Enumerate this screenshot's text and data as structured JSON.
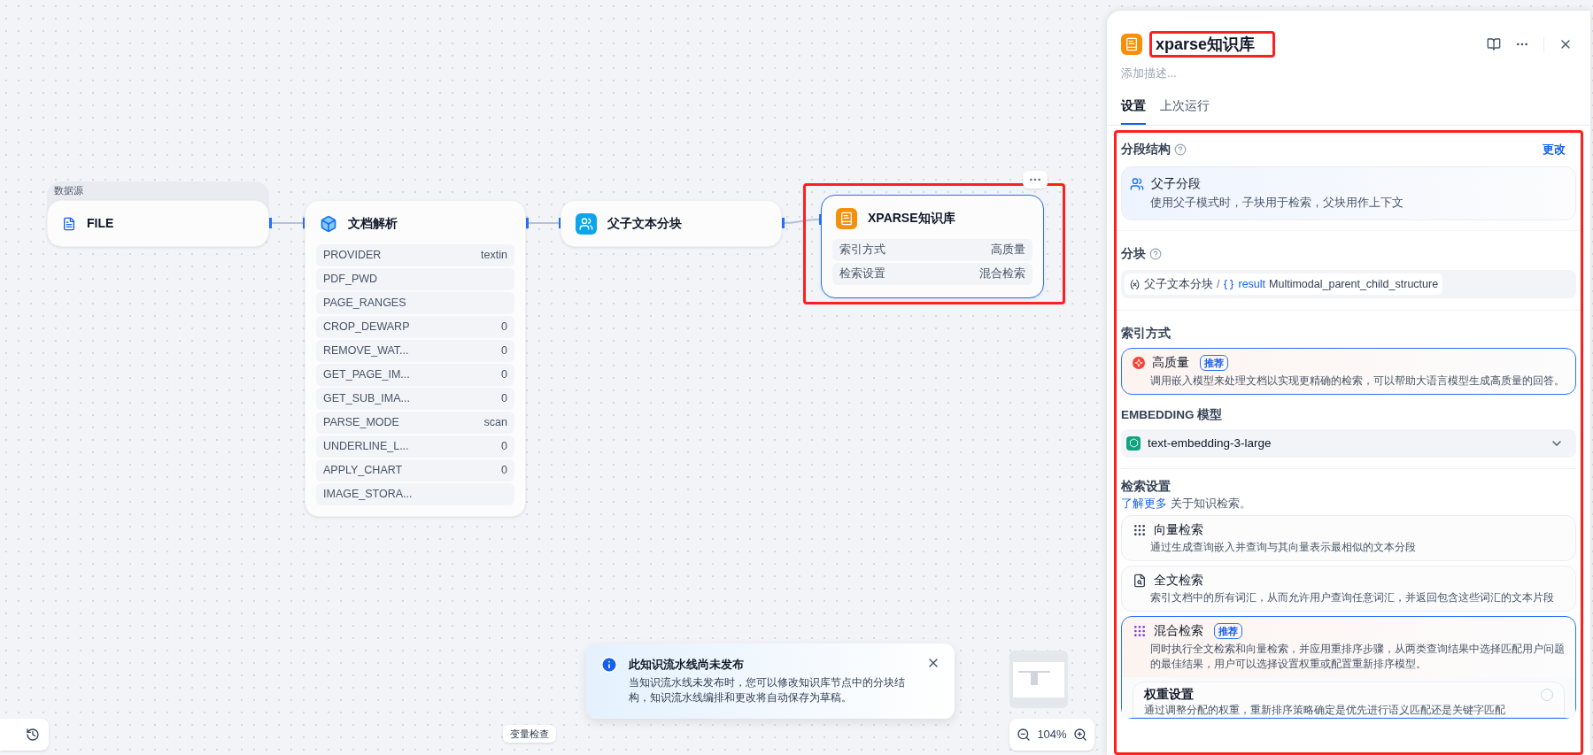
{
  "canvas": {
    "nodes": [
      {
        "kind": "source",
        "group_label": "数据源",
        "title": "FILE"
      },
      {
        "kind": "params",
        "title": "文档解析",
        "params": [
          {
            "name": "PROVIDER",
            "value": "textin"
          },
          {
            "name": "PDF_PWD"
          },
          {
            "name": "PAGE_RANGES"
          },
          {
            "name": "CROP_DEWARP",
            "value": "0"
          },
          {
            "name": "REMOVE_WAT...",
            "value": "0"
          },
          {
            "name": "GET_PAGE_IM...",
            "value": "0"
          },
          {
            "name": "GET_SUB_IMA...",
            "value": "0"
          },
          {
            "name": "PARSE_MODE",
            "value": "scan"
          },
          {
            "name": "UNDERLINE_L...",
            "value": "0"
          },
          {
            "name": "APPLY_CHART",
            "value": "0"
          },
          {
            "name": "IMAGE_STORA..."
          }
        ]
      },
      {
        "kind": "simple",
        "title": "父子文本分块"
      },
      {
        "kind": "knowledge",
        "title": "XPARSE知识库",
        "highlighted": true,
        "selected": true,
        "params": [
          {
            "name": "索引方式",
            "value": "高质量"
          },
          {
            "name": "检索设置",
            "value": "混合检索"
          }
        ]
      }
    ],
    "variable_inspect_button": "变量检查",
    "toast": {
      "title": "此知识流水线尚未发布",
      "message": "当知识流水线未发布时，您可以修改知识库节点中的分块结构，知识流水线编排和更改将自动保存为草稿。"
    },
    "zoom": "104%"
  },
  "panel": {
    "title": "xparse知识库",
    "title_highlighted": true,
    "description_placeholder": "添加描述...",
    "tabs": [
      {
        "label": "设置",
        "selected": true
      },
      {
        "label": "上次运行",
        "selected": false
      }
    ],
    "body_highlighted": true,
    "segment_structure": {
      "label": "分段结构",
      "action": "更改",
      "option": {
        "title": "父子分段",
        "description": "使用父子模式时，子块用于检索，父块用作上下文"
      }
    },
    "chunk": {
      "label": "分块",
      "node": "父子文本分块",
      "separator": "/",
      "variable": "result",
      "value": "Multimodal_parent_child_structure"
    },
    "index_method": {
      "label": "索引方式",
      "options": [
        {
          "title": "高质量",
          "badge": "推荐",
          "description": "调用嵌入模型来处理文档以实现更精确的检索，可以帮助大语言模型生成高质量的回答。",
          "selected": true
        }
      ]
    },
    "embedding": {
      "label": "EMBEDDING 模型",
      "value": "text-embedding-3-large"
    },
    "retrieval": {
      "label": "检索设置",
      "link": "了解更多",
      "link_suffix": "关于知识检索。",
      "options": [
        {
          "kind": "vector",
          "title": "向量检索",
          "description": "通过生成查询嵌入并查询与其向量表示最相似的文本分段",
          "selected": false
        },
        {
          "kind": "fulltext",
          "title": "全文检索",
          "description": "索引文档中的所有词汇，从而允许用户查询任意词汇，并返回包含这些词汇的文本片段",
          "selected": false
        },
        {
          "kind": "hybrid",
          "title": "混合检索",
          "badge": "推荐",
          "description": "同时执行全文检索和向量检索，并应用重排序步骤，从两类查询结果中选择匹配用户问题的最佳结果，用户可以选择设置权重或配置重新排序模型。",
          "selected": true,
          "sub_options": [
            {
              "title": "权重设置",
              "description": "通过调整分配的权重，重新排序策略确定是优先进行语义匹配还是关键字匹配",
              "selected": false
            }
          ]
        }
      ]
    }
  }
}
